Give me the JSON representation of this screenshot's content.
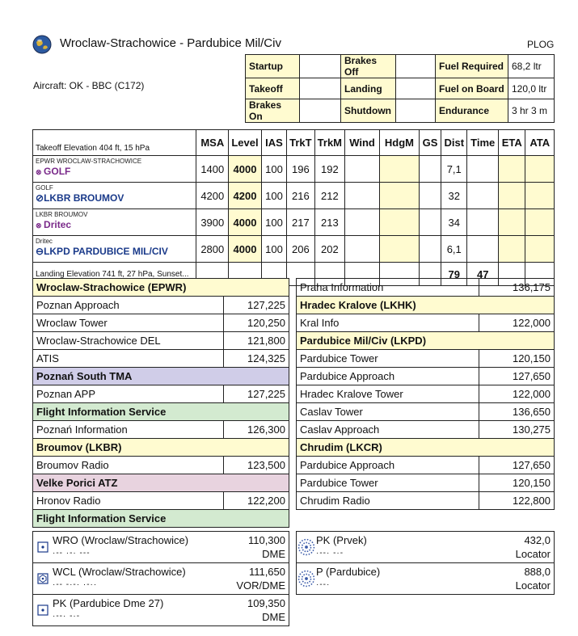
{
  "header": {
    "title": "Wroclaw-Strachowice - Pardubice Mil/Civ",
    "plog": "PLOG",
    "aircraft": "Aircraft:  OK - BBC (C172)"
  },
  "times": [
    [
      "Startup",
      "",
      "Brakes Off",
      "",
      "Fuel Required",
      "68,2 ltr"
    ],
    [
      "Takeoff",
      "",
      "Landing",
      "",
      "Fuel on Board",
      "120,0 ltr"
    ],
    [
      "Brakes On",
      "",
      "Shutdown",
      "",
      "Endurance",
      "3 hr 3 m"
    ]
  ],
  "nav": {
    "header_left": "Takeoff Elevation 404 ft, 15 hPa",
    "columns": [
      "MSA",
      "Level",
      "IAS",
      "TrkT",
      "TrkM",
      "Wind",
      "HdgM",
      "GS",
      "Dist",
      "Time",
      "ETA",
      "ATA"
    ],
    "rows": [
      {
        "from": "EPWR WROCLAW-STRACHOWICE",
        "to": "GOLF",
        "msa": "1400",
        "level": "4000",
        "ias": "100",
        "trkt": "196",
        "trkm": "192",
        "dist": "7,1"
      },
      {
        "from": "GOLF",
        "to": "LKBR BROUMOV",
        "msa": "4200",
        "level": "4200",
        "ias": "100",
        "trkt": "216",
        "trkm": "212",
        "dist": "32"
      },
      {
        "from": "LKBR BROUMOV",
        "to": "Dritec",
        "msa": "3900",
        "level": "4000",
        "ias": "100",
        "trkt": "217",
        "trkm": "213",
        "dist": "34"
      },
      {
        "from": "Dritec",
        "to": "LKPD PARDUBICE MIL/CIV",
        "msa": "2800",
        "level": "4000",
        "ias": "100",
        "trkt": "206",
        "trkm": "202",
        "dist": "6,1"
      }
    ],
    "footer_left": "Landing Elevation 741 ft, 27 hPa, Sunset...",
    "total_dist": "79",
    "total_time": "47"
  },
  "freq_left": [
    {
      "label": "Wroclaw-Strachowice (EPWR)",
      "style": "yel",
      "header": true
    },
    {
      "label": "Poznan Approach",
      "value": "127,225"
    },
    {
      "label": "Wroclaw Tower",
      "value": "120,250"
    },
    {
      "label": "Wroclaw-Strachowice DEL",
      "value": "121,800"
    },
    {
      "label": "ATIS",
      "value": "124,325"
    },
    {
      "label": "Poznań South TMA",
      "style": "pur",
      "header": true
    },
    {
      "label": "Poznan APP",
      "value": "127,225"
    },
    {
      "label": "Flight Information Service",
      "style": "grn",
      "header": true
    },
    {
      "label": "Poznań Information",
      "value": "126,300"
    },
    {
      "label": "Broumov (LKBR)",
      "style": "yel",
      "header": true
    },
    {
      "label": "Broumov Radio",
      "value": "123,500"
    },
    {
      "label": "Velke Porici ATZ",
      "style": "pnk",
      "header": true
    },
    {
      "label": "Hronov Radio",
      "value": "122,200"
    },
    {
      "label": "Flight Information Service",
      "style": "grn",
      "header": true
    }
  ],
  "freq_right": [
    {
      "label": "Praha Information",
      "value": "136,175"
    },
    {
      "label": "Hradec Kralove (LKHK)",
      "style": "yel",
      "header": true
    },
    {
      "label": "Kral Info",
      "value": "122,000"
    },
    {
      "label": "Pardubice Mil/Civ (LKPD)",
      "style": "yel",
      "header": true
    },
    {
      "label": "Pardubice Tower",
      "value": "120,150"
    },
    {
      "label": "Pardubice Approach",
      "value": "127,650"
    },
    {
      "label": "Hradec Kralove Tower",
      "value": "122,000"
    },
    {
      "label": "Caslav Tower",
      "value": "136,650"
    },
    {
      "label": "Caslav Approach",
      "value": "130,275"
    },
    {
      "label": "Chrudim (LKCR)",
      "style": "yel",
      "header": true
    },
    {
      "label": "Pardubice Approach",
      "value": "127,650"
    },
    {
      "label": "Pardubice Tower",
      "value": "120,150"
    },
    {
      "label": "Chrudim Radio",
      "value": "122,800"
    }
  ],
  "navaids_left": [
    {
      "name": "WRO (Wroclaw/Strachowice)",
      "morse": "·-- ·-· ---",
      "freq": "110,300",
      "type": "DME",
      "icon": "dme-icon"
    },
    {
      "name": "WCL (Wroclaw/Strachowice)",
      "morse": "·-- -·-· ·-··",
      "freq": "111,650",
      "type": "VOR/DME",
      "icon": "vor-dme-icon"
    },
    {
      "name": "PK (Pardubice Dme 27)",
      "morse": "·--· -·-",
      "freq": "109,350",
      "type": "DME",
      "icon": "dme-icon"
    }
  ],
  "navaids_right": [
    {
      "name": "PK (Prvek)",
      "morse": "·--· -·-",
      "freq": "432,0",
      "type": "Locator",
      "icon": "ndb-icon"
    },
    {
      "name": "P (Pardubice)",
      "morse": "·--·",
      "freq": "888,0",
      "type": "Locator",
      "icon": "ndb-icon"
    }
  ]
}
